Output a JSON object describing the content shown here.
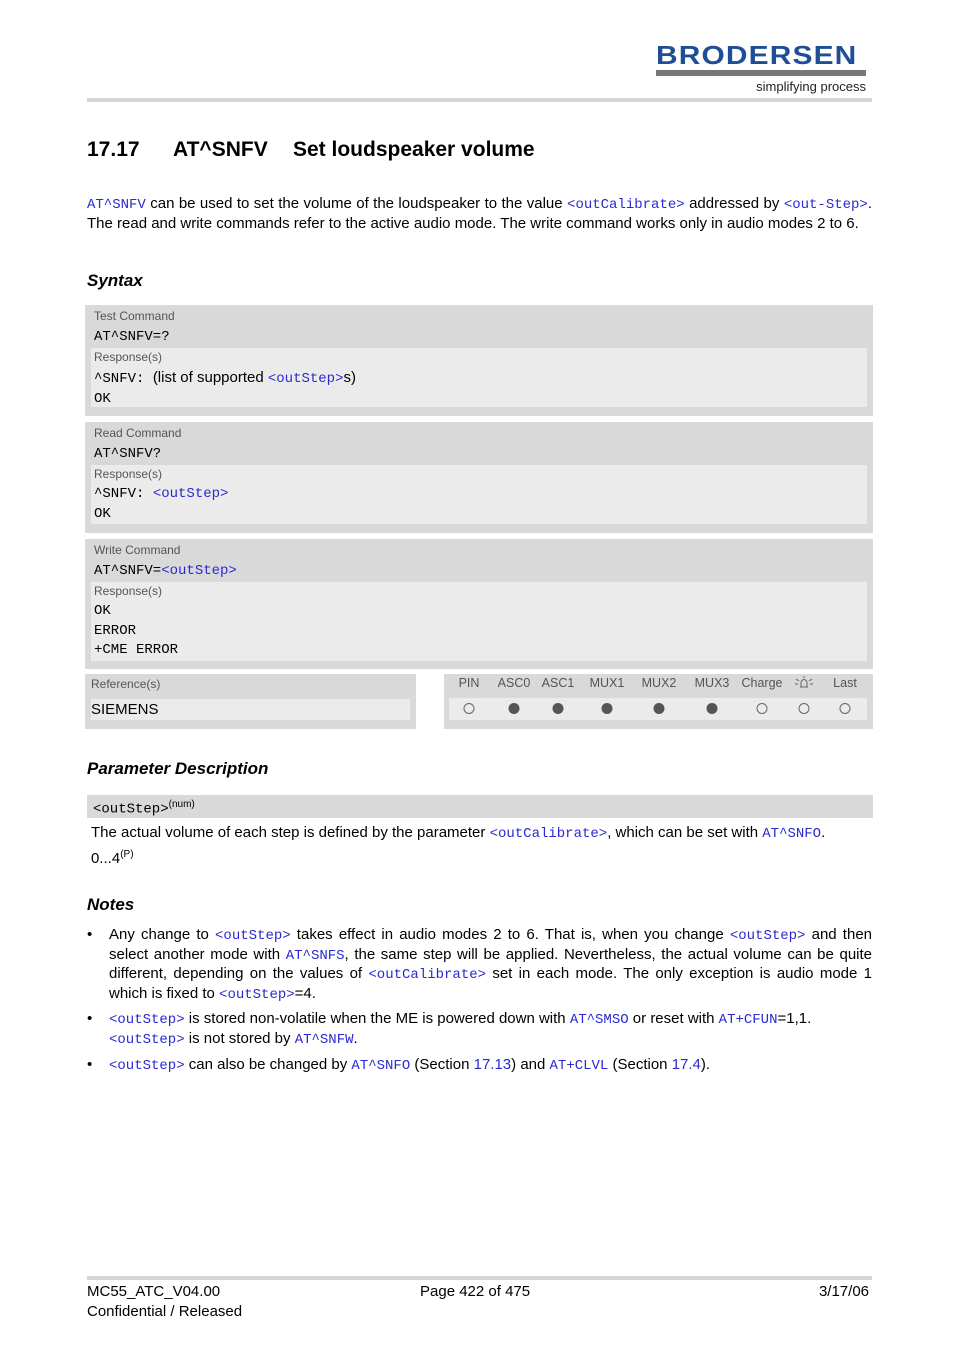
{
  "header": {
    "brand": "BRODERSEN",
    "tagline": "simplifying process"
  },
  "section": {
    "number": "17.17",
    "command": "AT^SNFV",
    "title": "Set loudspeaker volume"
  },
  "intro": {
    "cmd_link": "AT^SNFV",
    "text1": " can be used to set the volume of the loudspeaker to the value ",
    "param1": "<outCalibrate>",
    "text2": " addressed by ",
    "param2": "<out-Step>",
    "text3": ". The read and write commands refer to the active audio mode. The write command works only in audio modes 2 to 6."
  },
  "syntax": {
    "heading": "Syntax",
    "test": {
      "label": "Test Command",
      "syntax": "AT^SNFV=?",
      "response_label": "Response(s)",
      "resp_prefix": "^SNFV: ",
      "resp_text1": " (list of supported ",
      "resp_param": "<outStep>",
      "resp_text2": "s)",
      "resp_ok": "OK"
    },
    "read": {
      "label": "Read Command",
      "syntax": "AT^SNFV?",
      "response_label": "Response(s)",
      "resp_prefix": "^SNFV: ",
      "resp_param": "<outStep>",
      "resp_ok": "OK"
    },
    "write": {
      "label": "Write Command",
      "syntax_prefix": "AT^SNFV=",
      "syntax_param": "<outStep>",
      "response_label": "Response(s)",
      "responses": [
        "OK",
        "ERROR",
        "+CME ERROR"
      ]
    },
    "reference": {
      "label": "Reference(s)",
      "value": "SIEMENS"
    },
    "interfaces": [
      {
        "name": "PIN",
        "supported": false
      },
      {
        "name": "ASC0",
        "supported": true
      },
      {
        "name": "ASC1",
        "supported": true
      },
      {
        "name": "MUX1",
        "supported": true
      },
      {
        "name": "MUX2",
        "supported": true
      },
      {
        "name": "MUX3",
        "supported": true
      },
      {
        "name": "Charge",
        "supported": false
      },
      {
        "name": "alarm-icon",
        "supported": false
      },
      {
        "name": "Last",
        "supported": false
      }
    ]
  },
  "parameters": {
    "heading": "Parameter Description",
    "name": "<outStep>",
    "type": "(num)",
    "desc_text1": "The actual volume of each step is defined by the parameter ",
    "desc_param": "<outCalibrate>",
    "desc_text2": ", which can be set with ",
    "desc_link": "AT^SNFO",
    "desc_text3": ".",
    "range": "0...4",
    "range_sup": "(P)"
  },
  "notes": {
    "heading": "Notes",
    "bullet": "•",
    "n1": {
      "t1": "Any change to ",
      "p1": "<outStep>",
      "t2": " takes effect in audio modes 2 to 6. That is, when you change ",
      "p2": "<outStep>",
      "t3": " and then select another mode with ",
      "l1": "AT^SNFS",
      "t4": ", the same step will be applied. Nevertheless, the actual volume can be quite different, depending on the values of ",
      "p3": "<outCalibrate>",
      "t5": " set in each mode. The only exception is audio mode 1 which is fixed to ",
      "p4": "<outStep>",
      "t6": "=4."
    },
    "n2": {
      "p1": "<outStep>",
      "t1": " is stored non-volatile when the ME is powered down with ",
      "l1": "AT^SMSO",
      "t2": " or reset with ",
      "l2": "AT+CFUN",
      "t3": "=1,1. ",
      "p2": "<outStep>",
      "t4": " is not stored by ",
      "l3": "AT^SNFW",
      "t5": "."
    },
    "n3": {
      "p1": "<outStep>",
      "t1": " can also be changed by ",
      "l1": "AT^SNFO",
      "t2": " (Section ",
      "s1": "17.13",
      "t3": ") and ",
      "l2": "AT+CLVL",
      "t4": " (Section ",
      "s2": "17.4",
      "t5": ")."
    }
  },
  "footer": {
    "doc_id": "MC55_ATC_V04.00",
    "status": "Confidential / Released",
    "page": "Page 422 of 475",
    "date": "3/17/06"
  }
}
